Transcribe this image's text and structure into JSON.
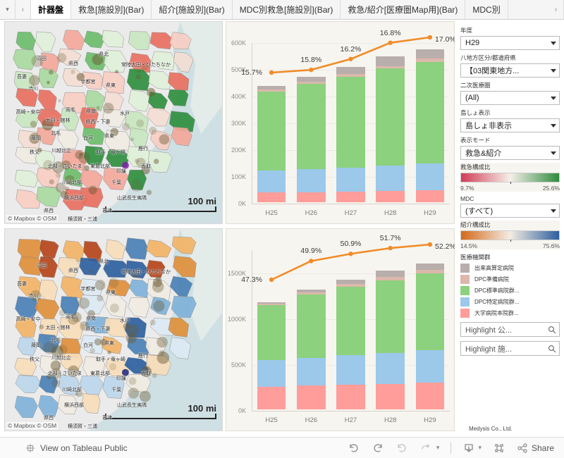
{
  "tabbar": {
    "menu_icon": "chevron-down-icon",
    "prev_icon": "chevron-left-icon",
    "next_icon": "chevron-right-icon",
    "tabs": [
      {
        "label": "計器盤",
        "active": true
      },
      {
        "label": "救急[施設別](Bar)",
        "active": false
      },
      {
        "label": "紹介[施設別](Bar)",
        "active": false
      },
      {
        "label": "MDC別救急[施設別](Bar)",
        "active": false
      },
      {
        "label": "救急/紹介[医療圏Map用](Bar)",
        "active": false
      },
      {
        "label": "MDC別",
        "active": false
      }
    ]
  },
  "maps": {
    "attribution": "© Mapbox  © OSM",
    "scale_label": "100 mi",
    "region_labels": [
      "沼田",
      "県西",
      "県北",
      "吾妻",
      "常陸太田・ひたちなか",
      "渋川",
      "宇都宮",
      "県東",
      "高崎・安中",
      "両毛",
      "県南",
      "水戸",
      "太田・館林",
      "県西・下妻",
      "藤岡",
      "北毛",
      "白河",
      "県東",
      "秩父",
      "川越比企",
      "取手・竜ヶ崎",
      "鹿行",
      "東葛北部",
      "北部・さいたま",
      "印旛",
      "香取",
      "川崎北部",
      "千葉",
      "横浜西部",
      "山武長生夷隅",
      "県西",
      "君津",
      "横須賀・三浦"
    ]
  },
  "chart_data": [
    {
      "id": "emergency",
      "type": "bar",
      "title": "",
      "xlabel": "",
      "ylabel": "",
      "categories": [
        "H25",
        "H26",
        "H27",
        "H28",
        "H29"
      ],
      "ylim": [
        0,
        600000
      ],
      "yticks": [
        "0K",
        "100K",
        "200K",
        "300K",
        "400K",
        "500K",
        "600K"
      ],
      "ytick_values": [
        0,
        100000,
        200000,
        300000,
        400000,
        500000,
        600000
      ],
      "grid": true,
      "series": [
        {
          "name": "大学病院本院群...",
          "color": "#ff9d9a",
          "values": [
            37000,
            38000,
            39500,
            42000,
            44000
          ]
        },
        {
          "name": "DPC特定病院群...",
          "color": "#9cc8ea",
          "values": [
            82000,
            84500,
            90000,
            95000,
            101000
          ]
        },
        {
          "name": "DPC標準病院群...",
          "color": "#8cd17d",
          "values": [
            294000,
            320000,
            340000,
            362000,
            380000
          ]
        },
        {
          "name": "DPC準備病院",
          "color": "#dcb8ac",
          "values": [
            7000,
            7500,
            8500,
            10000,
            11000
          ]
        },
        {
          "name": "出来高算定病院",
          "color": "#b8aeac",
          "values": [
            14000,
            18000,
            27000,
            35000,
            34000
          ]
        }
      ],
      "line": {
        "name": "救急構成比",
        "color": "#f08c28",
        "labels": [
          "15.7%",
          "15.8%",
          "16.2%",
          "16.8%",
          "17.0%"
        ],
        "values": [
          15.7,
          15.8,
          16.2,
          16.8,
          17.0
        ]
      }
    },
    {
      "id": "referral",
      "type": "bar",
      "title": "",
      "xlabel": "",
      "ylabel": "",
      "categories": [
        "H25",
        "H26",
        "H27",
        "H28",
        "H29"
      ],
      "ylim": [
        0,
        1750000
      ],
      "yticks": [
        "0K",
        "500K",
        "1000K",
        "1500K"
      ],
      "ytick_values": [
        0,
        500000,
        1000000,
        1500000
      ],
      "grid": true,
      "series": [
        {
          "name": "大学病院本院群...",
          "color": "#ff9d9a",
          "values": [
            245000,
            258000,
            268000,
            280000,
            292000
          ]
        },
        {
          "name": "DPC特定病院群...",
          "color": "#9cc8ea",
          "values": [
            290000,
            305000,
            320000,
            335000,
            352000
          ]
        },
        {
          "name": "DPC標準病院群...",
          "color": "#8cd17d",
          "values": [
            600000,
            690000,
            745000,
            790000,
            838000
          ]
        },
        {
          "name": "DPC準備病院",
          "color": "#dcb8ac",
          "values": [
            20000,
            24000,
            30000,
            36000,
            40000
          ]
        },
        {
          "name": "出来高算定病院",
          "color": "#b8aeac",
          "values": [
            14000,
            30000,
            50000,
            68000,
            66000
          ]
        }
      ],
      "line": {
        "name": "紹介構成比",
        "color": "#f08c28",
        "labels": [
          "47.3%",
          "49.9%",
          "50.9%",
          "51.7%",
          "52.2%"
        ],
        "values": [
          47.3,
          49.9,
          50.9,
          51.7,
          52.2
        ]
      }
    }
  ],
  "sidebar": {
    "filters": [
      {
        "label": "年度",
        "value": "H29",
        "name": "year-select"
      },
      {
        "label": "八地方区分/都道府県",
        "value": "【03関東地方...",
        "name": "region-division-select"
      },
      {
        "label": "二次医療圏",
        "value": "(All)",
        "name": "secondary-medical-area-select"
      },
      {
        "label": "島しょ表示",
        "value": "島しょ非表示",
        "name": "island-display-select"
      },
      {
        "label": "表示モード",
        "value": "救急&紹介",
        "name": "display-mode-select"
      }
    ],
    "gradient_emergency": {
      "title": "救急構成比",
      "min": "9.7%",
      "max": "25.6%",
      "color_low": "#d13b56",
      "color_mid": "#f5efe8",
      "color_high": "#2e8b3d"
    },
    "mdc": {
      "label": "MDC",
      "value": "(すべて)",
      "name": "mdc-select"
    },
    "gradient_referral": {
      "title": "紹介構成比",
      "min": "14.5%",
      "max": "75.6%",
      "color_low": "#d4691a",
      "color_mid": "#f3ece2",
      "color_high": "#2d5f9e"
    },
    "institution_legend": {
      "title": "医療機関群",
      "items": [
        {
          "label": "出来高算定病院",
          "color": "#b8aeac"
        },
        {
          "label": "DPC準備病院",
          "color": "#dcb8ac"
        },
        {
          "label": "DPC標準病院群...",
          "color": "#8cd17d"
        },
        {
          "label": "DPC特定病院群...",
          "color": "#9cc8ea"
        },
        {
          "label": "大学病院本院群...",
          "color": "#ff9d9a"
        }
      ]
    },
    "searches": [
      {
        "value": "Highlight 公...",
        "icon": "search-icon",
        "name": "highlight-public-search"
      },
      {
        "value": "Highlight 施...",
        "icon": "search-icon",
        "name": "highlight-facility-search"
      }
    ],
    "credit": "Medysis Co., Ltd."
  },
  "toolbar": {
    "view_label": "View on Tableau Public",
    "tableau_icon": "tableau-logo-icon",
    "undo_icon": "undo-icon",
    "redo_icon": "redo-icon",
    "revert_icon": "revert-icon",
    "refresh_icon": "refresh-icon",
    "pause_caret_icon": "chevron-down-icon",
    "download_icon": "download-icon",
    "download_caret_icon": "chevron-down-icon",
    "fullscreen_icon": "fullscreen-icon",
    "share_icon": "share-icon",
    "share_label": "Share"
  }
}
